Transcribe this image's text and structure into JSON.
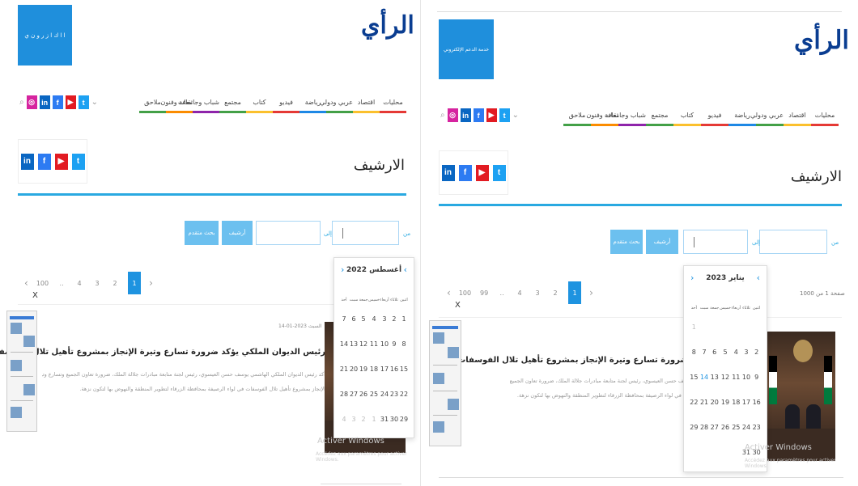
{
  "site": {
    "logo_text": "الرأي"
  },
  "header": {
    "left_banner": "ا ا ك ا ز ر و ن ي",
    "right_banner": "خدمة الدعم الإلكتروني"
  },
  "nav": {
    "items": [
      "محليات",
      "اقتصاد",
      "عربي ودولي",
      "رياضة",
      "فيديو",
      "كتاب",
      "مجتمع",
      "شباب وجامعات",
      "ثقافة وفنون",
      "ملاحق"
    ],
    "colors": [
      "#e53935",
      "#fbc02d",
      "#43a047",
      "#1e88e5",
      "#e53935",
      "#fbc02d",
      "#43a047",
      "#8e24aa",
      "#fb8c00",
      "#43a047"
    ]
  },
  "social": {
    "twitter": "t",
    "youtube": "▶",
    "facebook": "f",
    "linkedin": "in",
    "instagram": "◎"
  },
  "archive": {
    "title": "الارشيف",
    "from_label": "من",
    "to_label": "إلى",
    "archive_button": "أرشيف",
    "advanced_search": "بحث متقدم"
  },
  "pagination": {
    "pages": [
      "1",
      "2",
      "3",
      "4",
      "..",
      "99",
      "100"
    ],
    "pages_left": [
      "1",
      "2",
      "3",
      "4",
      "..",
      "100"
    ],
    "prev": "‹",
    "next": "›",
    "count_text": "صفحة 1 من 1000"
  },
  "calendar_left": {
    "title": "أغسطس 2022",
    "weekdays": [
      "اثنين",
      "ثلاثاء",
      "أربعاء",
      "خميس",
      "جمعة",
      "سبت",
      "أحد"
    ],
    "rows": [
      [
        "1",
        "2",
        "3",
        "4",
        "5",
        "6",
        "7"
      ],
      [
        "8",
        "9",
        "10",
        "11",
        "12",
        "13",
        "14"
      ],
      [
        "15",
        "16",
        "17",
        "18",
        "19",
        "20",
        "21"
      ],
      [
        "22",
        "23",
        "24",
        "25",
        "26",
        "27",
        "28"
      ],
      [
        "29",
        "30",
        "31",
        "1",
        "2",
        "3",
        "4"
      ]
    ]
  },
  "calendar_right": {
    "title": "يناير 2023",
    "weekdays": [
      "اثنين",
      "ثلاثاء",
      "أربعاء",
      "خميس",
      "جمعة",
      "سبت",
      "أحد"
    ],
    "rows": [
      [
        "",
        "",
        "",
        "",
        "",
        "",
        "1"
      ],
      [
        "2",
        "3",
        "4",
        "5",
        "6",
        "7",
        "8"
      ],
      [
        "9",
        "10",
        "11",
        "12",
        "13",
        "14",
        "15"
      ],
      [
        "16",
        "17",
        "18",
        "19",
        "20",
        "21",
        "22"
      ],
      [
        "23",
        "24",
        "25",
        "26",
        "27",
        "28",
        "29"
      ],
      [
        "30",
        "31",
        "",
        "",
        "",
        "",
        ""
      ]
    ]
  },
  "article": {
    "date": "السبت 2023-01-14",
    "title": "رئيس الديوان الملكي يؤكد ضرورة تسارع وتيرة الإنجاز بمشروع تأهيل تلال الفوسفات",
    "title_cut": "ضرورة تسارع وتيرة الإنجاز بمشروع تأهيل تلال الفوسفات",
    "body_1": "أكد رئيس الديوان الملكي الهاشمي يوسف حسن العيسوي، رئيس لجنة متابعة مبادرات جلالة الملك، ضرورة تعاون الجميع وتسارع وتيرة",
    "body_2": "الإنجاز بمشروع تأهيل تلال الفوسفات في لواء الرصيفة بمحافظة الزرقاء لتطوير المنطقة والنهوض بها لتكون نزهة.",
    "body_r1": "سف حسن العيسوي، رئيس لجنة متابعة مبادرات جلالة الملك، ضرورة تعاون الجميع وتسارع وتيرة",
    "body_r2": "ت في لواء الرصيفة بمحافظة الزرقاء لتطوير المنطقة والنهوض بها لتكون نزهة."
  },
  "overlay": {
    "close": "X",
    "activate_title": "Activer Windows",
    "activate_sub": "Accédez aux paramètres pour activer Windows."
  }
}
